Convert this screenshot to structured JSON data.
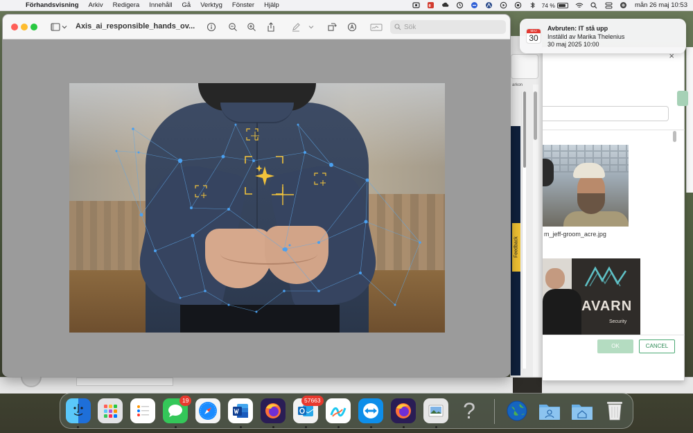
{
  "menubar": {
    "apple_glyph": "",
    "app_name": "Förhandsvisning",
    "items": [
      "Arkiv",
      "Redigera",
      "Innehåll",
      "Gå",
      "Verktyg",
      "Fönster",
      "Hjälp"
    ],
    "battery": "74 %",
    "clock": "mån 26 maj 10:53",
    "status_icons": [
      "screenshot-icon",
      "dropbox-icon",
      "creative-cloud-icon",
      "sync-icon",
      "minus-circle-icon",
      "nord-icon",
      "play-icon",
      "record-icon",
      "bluetooth-icon",
      "battery-icon",
      "wifi-icon",
      "search-icon",
      "control-center-icon",
      "siri-icon"
    ]
  },
  "preview": {
    "doc_title": "Axis_ai_responsible_hands_ov...",
    "search_placeholder": "Sök",
    "toolbar_icons": [
      "sidebar-icon",
      "chevron-down-icon",
      "info-icon",
      "zoom-out-icon",
      "zoom-in-icon",
      "share-icon",
      "markup-pen-icon",
      "chevron-down-icon",
      "rotate-icon",
      "annotate-icon",
      "sign-icon"
    ]
  },
  "notification": {
    "cal_month": "MAJ",
    "cal_day": "30",
    "title": "Avbruten: IT stå upp",
    "line1": "Inställd av Marika Thelenius",
    "line2": "30 maj 2025 10:00"
  },
  "background_window": {
    "strip_label": "arkon",
    "feedback_label": "Feedback"
  },
  "dialog": {
    "close_glyph": "×",
    "image1_caption": "m_jeff-groom_acre.jpg",
    "image2_logo_text": "AVARN",
    "image2_logo_sub": "Security",
    "ok_label": "OK",
    "cancel_label": "CANCEL"
  },
  "dock": {
    "apps": [
      {
        "name": "Finder",
        "color": "#1e88e5"
      },
      {
        "name": "Launchpad",
        "color": "#d9d9d9"
      },
      {
        "name": "Reminders",
        "color": "#ffffff"
      },
      {
        "name": "Messages",
        "color": "#34c759",
        "badge": "19"
      },
      {
        "name": "Safari",
        "color": "#1a8cff"
      },
      {
        "name": "Word",
        "color": "#2b5797"
      },
      {
        "name": "Firefox",
        "color": "#3b1f6b"
      },
      {
        "name": "Outlook",
        "color": "#0f6cbd",
        "badge": "57663"
      },
      {
        "name": "Freeform",
        "color": "#ffffff"
      },
      {
        "name": "TeamViewer",
        "color": "#0e8ee9"
      },
      {
        "name": "Firefox",
        "color": "#3b1f6b"
      },
      {
        "name": "Preview",
        "color": "#d9d9d9"
      },
      {
        "name": "Unknown",
        "color": "transparent"
      },
      {
        "name": "Globe",
        "color": "#1565c0"
      },
      {
        "name": "User folder",
        "color": "#6ab0e8"
      },
      {
        "name": "Home folder",
        "color": "#6ab0e8"
      },
      {
        "name": "Trash",
        "color": "#e0e0e0"
      }
    ],
    "unknown_glyph": "?"
  }
}
